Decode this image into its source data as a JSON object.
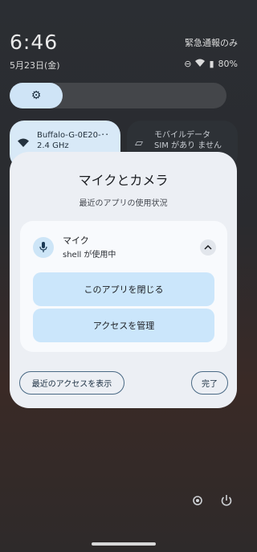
{
  "status": {
    "time": "6:46",
    "date": "5月23日(金)",
    "emergency": "緊急通報のみ",
    "battery": "80%"
  },
  "quick_settings": {
    "wifi_tile": {
      "line1": "Buffalo-G-0E20-･･",
      "line2": "2.4 GHz"
    },
    "mobile_tile": {
      "line1": "モバイルデータ",
      "line2": "SIM があり ません"
    }
  },
  "dialog": {
    "title": "マイクとカメラ",
    "subtitle": "最近のアプリの使用状況",
    "item": {
      "name": "マイク",
      "desc": "shell が使用中"
    },
    "close_app_label": "このアプリを閉じる",
    "manage_access_label": "アクセスを管理",
    "recent_access_label": "最近のアクセスを表示",
    "done_label": "完了"
  },
  "icons": {
    "brightness": "brightness-icon",
    "mic": "mic-icon",
    "collapse": "chevron-up-icon",
    "settings": "gear-icon",
    "power": "power-icon"
  }
}
